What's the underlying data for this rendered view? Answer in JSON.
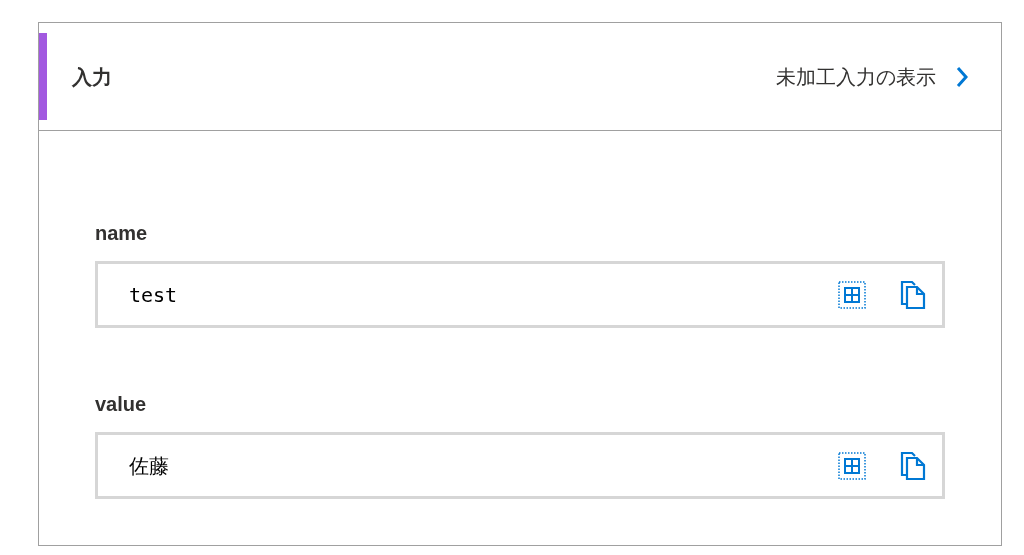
{
  "header": {
    "title": "入力",
    "link": "未加工入力の表示"
  },
  "fields": [
    {
      "label": "name",
      "value": "test"
    },
    {
      "label": "value",
      "value": "佐藤"
    }
  ]
}
